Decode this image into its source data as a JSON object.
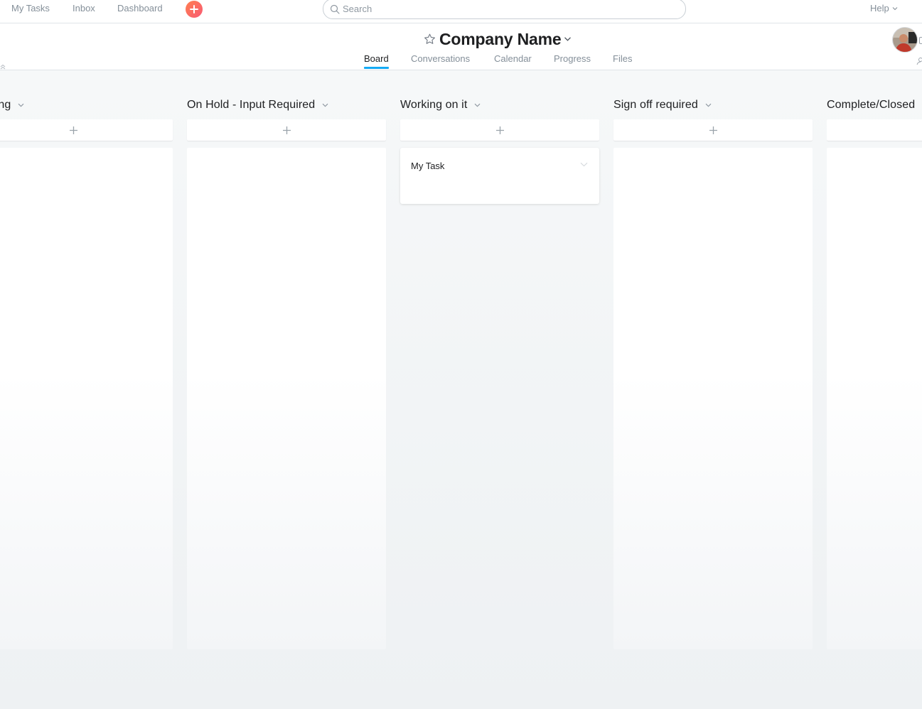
{
  "topnav": {
    "items": [
      "My Tasks",
      "Inbox",
      "Dashboard"
    ],
    "add_icon": "plus-icon",
    "accent": "#f95d6a"
  },
  "search": {
    "placeholder": "Search",
    "value": ""
  },
  "help": {
    "label": "Help"
  },
  "project": {
    "title": "Company Name",
    "tabs": [
      "Board",
      "Conversations",
      "Calendar",
      "Progress",
      "Files"
    ],
    "active_tab": "Board",
    "tab_accent": "#14aaf5"
  },
  "board": {
    "columns": [
      {
        "title": "tigating",
        "has_chevron": true,
        "tasks": []
      },
      {
        "title": "On Hold - Input Required",
        "has_chevron": true,
        "tasks": []
      },
      {
        "title": "Working on it",
        "has_chevron": true,
        "tasks": [
          {
            "name": "My Task"
          }
        ]
      },
      {
        "title": "Sign off required",
        "has_chevron": true,
        "tasks": []
      },
      {
        "title": "Complete/Closed",
        "has_chevron": false,
        "tasks": []
      }
    ]
  }
}
